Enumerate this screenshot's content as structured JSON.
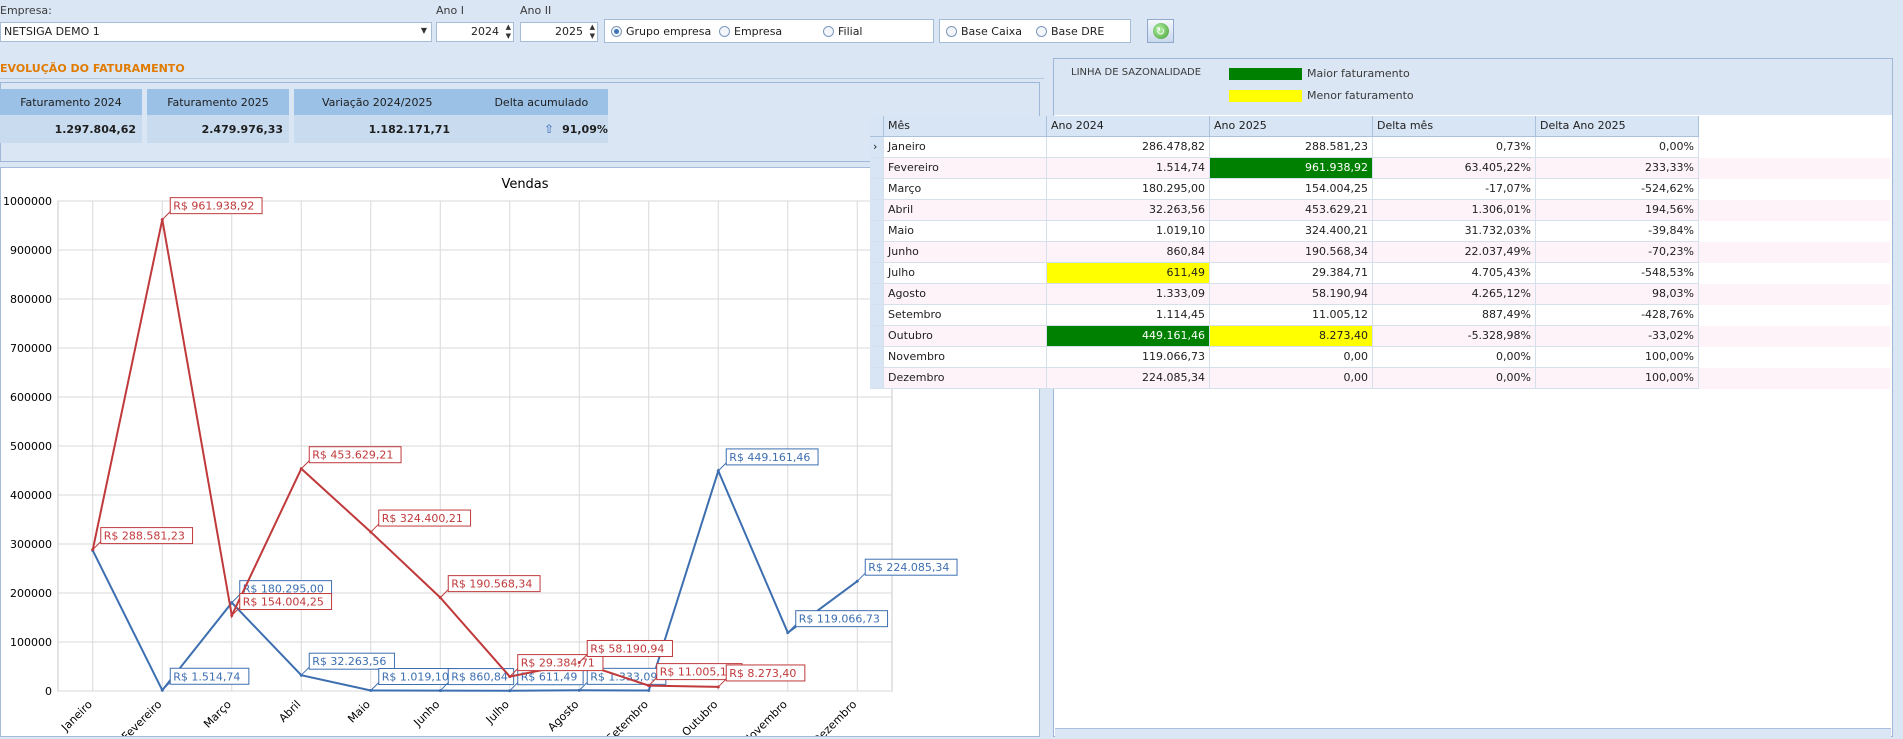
{
  "filters": {
    "empresa_label": "Empresa:",
    "empresa_value": "NETSIGA DEMO 1",
    "ano1_label": "Ano I",
    "ano1_value": "2024",
    "ano2_label": "Ano II",
    "ano2_value": "2025",
    "scope_options": [
      {
        "label": "Grupo empresa",
        "selected": true
      },
      {
        "label": "Empresa",
        "selected": false
      },
      {
        "label": "Filial",
        "selected": false
      }
    ],
    "base_options": [
      {
        "label": "Base Caixa",
        "selected": false
      },
      {
        "label": "Base DRE",
        "selected": false
      }
    ],
    "refresh_icon": "refresh-icon"
  },
  "evolucao": {
    "title": "EVOLUÇÃO DO FATURAMENTO",
    "kpis": {
      "fat1_label": "Faturamento 2024",
      "fat1_value": "1.297.804,62",
      "fat2_label": "Faturamento 2025",
      "fat2_value": "2.479.976,33",
      "var_label": "Variação 2024/2025",
      "var_value": "1.182.171,71",
      "delta_label": "Delta acumulado",
      "delta_value": "91,09%"
    }
  },
  "chart_data": {
    "type": "line",
    "title": "Vendas",
    "categories": [
      "Janeiro",
      "Fevereiro",
      "Março",
      "Abril",
      "Maio",
      "Junho",
      "Julho",
      "Agosto",
      "Setembro",
      "Outubro",
      "Novembro",
      "Dezembro"
    ],
    "ylim": [
      0,
      1000000
    ],
    "yticks": [
      0,
      100000,
      200000,
      300000,
      400000,
      500000,
      600000,
      700000,
      800000,
      900000,
      1000000
    ],
    "grid": true,
    "legend_position": "top-right",
    "series": [
      {
        "name": "2024",
        "color": "#3d6fb0",
        "values": [
          286478.82,
          1514.74,
          180295.0,
          32263.56,
          1019.1,
          860.84,
          611.49,
          1333.09,
          1114.45,
          449161.46,
          119066.73,
          224085.34
        ],
        "labels": [
          "",
          "R$ 1.514,74",
          "R$ 180.295,00",
          "R$ 32.263,56",
          "R$ 1.019,10",
          "R$ 860,84",
          "R$ 611,49",
          "R$ 1.333,09",
          "",
          "R$ 449.161,46",
          "R$ 119.066,73",
          "R$ 224.085,34"
        ]
      },
      {
        "name": "2025",
        "color": "#c0393b",
        "values": [
          288581.23,
          961938.92,
          154004.25,
          453629.21,
          324400.21,
          190568.34,
          29384.71,
          58190.94,
          11005.12,
          8273.4,
          null,
          null
        ],
        "labels": [
          "R$ 288.581,23",
          "R$ 961.938,92",
          "R$ 154.004,25",
          "R$ 453.629,21",
          "R$ 324.400,21",
          "R$ 190.568,34",
          "R$ 29.384,71",
          "R$ 58.190,94",
          "R$ 11.005,12",
          "R$ 8.273,40",
          "",
          ""
        ]
      }
    ]
  },
  "sazonalidade": {
    "title": "LINHA DE SAZONALIDADE",
    "legend": [
      {
        "label": "Maior faturamento",
        "color": "#008000"
      },
      {
        "label": "Menor faturamento",
        "color": "#ffff00"
      }
    ],
    "table": {
      "columns": [
        "Mês",
        "Ano 2024",
        "Ano 2025",
        "Delta mês",
        "Delta Ano 2025"
      ],
      "rows": [
        {
          "mes": "Janeiro",
          "a2024": "286.478,82",
          "a2025": "288.581,23",
          "dmes": "0,73%",
          "dano": "0,00%"
        },
        {
          "mes": "Fevereiro",
          "a2024": "1.514,74",
          "a2025": "961.938,92",
          "dmes": "63.405,22%",
          "dano": "233,33%"
        },
        {
          "mes": "Março",
          "a2024": "180.295,00",
          "a2025": "154.004,25",
          "dmes": "-17,07%",
          "dano": "-524,62%"
        },
        {
          "mes": "Abril",
          "a2024": "32.263,56",
          "a2025": "453.629,21",
          "dmes": "1.306,01%",
          "dano": "194,56%"
        },
        {
          "mes": "Maio",
          "a2024": "1.019,10",
          "a2025": "324.400,21",
          "dmes": "31.732,03%",
          "dano": "-39,84%"
        },
        {
          "mes": "Junho",
          "a2024": "860,84",
          "a2025": "190.568,34",
          "dmes": "22.037,49%",
          "dano": "-70,23%"
        },
        {
          "mes": "Julho",
          "a2024": "611,49",
          "a2025": "29.384,71",
          "dmes": "4.705,43%",
          "dano": "-548,53%"
        },
        {
          "mes": "Agosto",
          "a2024": "1.333,09",
          "a2025": "58.190,94",
          "dmes": "4.265,12%",
          "dano": "98,03%"
        },
        {
          "mes": "Setembro",
          "a2024": "1.114,45",
          "a2025": "11.005,12",
          "dmes": "887,49%",
          "dano": "-428,76%"
        },
        {
          "mes": "Outubro",
          "a2024": "449.161,46",
          "a2025": "8.273,40",
          "dmes": "-5.328,98%",
          "dano": "-33,02%"
        },
        {
          "mes": "Novembro",
          "a2024": "119.066,73",
          "a2025": "0,00",
          "dmes": "0,00%",
          "dano": "100,00%"
        },
        {
          "mes": "Dezembro",
          "a2024": "224.085,34",
          "a2025": "0,00",
          "dmes": "0,00%",
          "dano": "100,00%"
        }
      ],
      "highlights": [
        {
          "row": 1,
          "col": "a2025",
          "color": "#008000",
          "text_color": "#ffffff"
        },
        {
          "row": 6,
          "col": "a2024",
          "color": "#ffff00",
          "text_color": "#1e1e1e"
        },
        {
          "row": 9,
          "col": "a2024",
          "color": "#008000",
          "text_color": "#ffffff"
        },
        {
          "row": 9,
          "col": "a2025",
          "color": "#ffff00",
          "text_color": "#1e1e1e"
        }
      ],
      "current_row_indicator": "row-pointer-icon"
    }
  }
}
